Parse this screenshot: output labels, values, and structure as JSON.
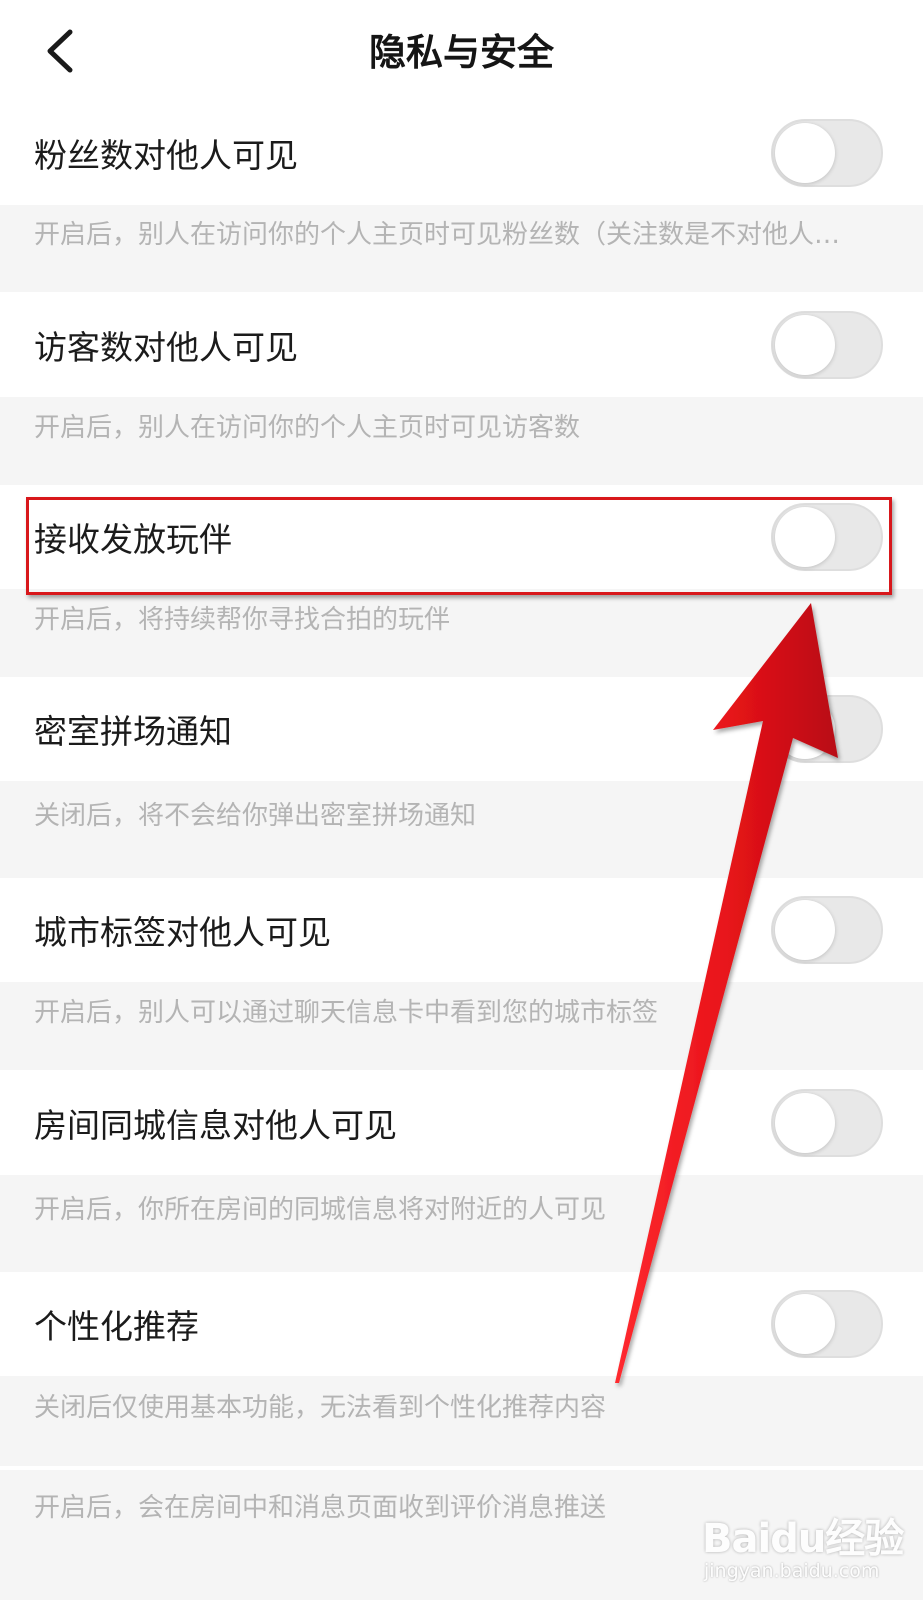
{
  "header": {
    "back_icon": "chevron-left-icon",
    "title": "隐私与安全"
  },
  "settings": [
    {
      "label": "粉丝数对他人可见",
      "enabled": false,
      "description": "开启后，别人在访问你的个人主页时可见粉丝数（关注数是不对他人…"
    },
    {
      "label": "访客数对他人可见",
      "enabled": false,
      "description": "开启后，别人在访问你的个人主页时可见访客数"
    },
    {
      "label": "接收发放玩伴",
      "enabled": false,
      "description": "开启后，将持续帮你寻找合拍的玩伴"
    },
    {
      "label": "密室拼场通知",
      "enabled": false,
      "description": "关闭后，将不会给你弹出密室拼场通知"
    },
    {
      "label": "城市标签对他人可见",
      "enabled": false,
      "description": "开启后，别人可以通过聊天信息卡中看到您的城市标签"
    },
    {
      "label": "房间同城信息对他人可见",
      "enabled": false,
      "description": "开启后，你所在房间的同城信息将对附近的人可见"
    },
    {
      "label": "个性化推荐",
      "enabled": false,
      "description": "关闭后仅使用基本功能，无法看到个性化推荐内容"
    }
  ],
  "last_description": "开启后，会在房间中和消息页面收到评价消息推送",
  "annotation": {
    "highlight_color": "#d8171b",
    "arrow_color": "#e8131a"
  },
  "watermark": {
    "brand": "Baidu经验",
    "url": "jingyan.baidu.com"
  }
}
